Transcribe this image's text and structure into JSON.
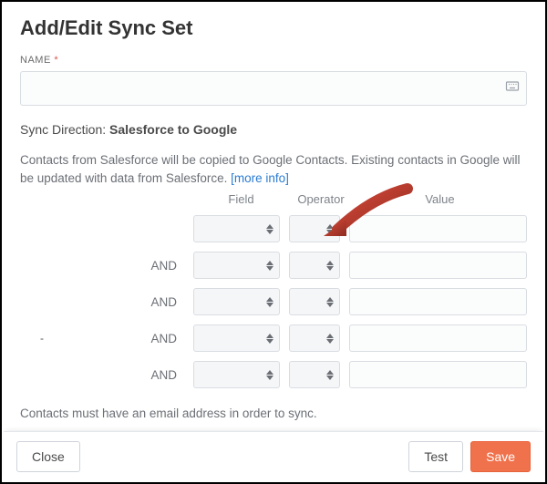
{
  "title": "Add/Edit Sync Set",
  "nameField": {
    "label": "NAME",
    "required": "*",
    "value": ""
  },
  "syncDirection": {
    "label": "Sync Direction:",
    "value": "Salesforce to Google"
  },
  "description": {
    "text": "Contacts from Salesforce will be copied to Google Contacts. Existing contacts in Google will be updated with data from Salesforce.",
    "moreLink": "[more info]"
  },
  "filterHeaders": {
    "field": "Field",
    "operator": "Operator",
    "value": "Value"
  },
  "filterRows": [
    {
      "and": "",
      "field": "",
      "operator": "",
      "value": ""
    },
    {
      "and": "AND",
      "field": "",
      "operator": "",
      "value": ""
    },
    {
      "and": "AND",
      "field": "",
      "operator": "",
      "value": ""
    },
    {
      "and": "AND",
      "field": "",
      "operator": "",
      "value": ""
    },
    {
      "and": "AND",
      "field": "",
      "operator": "",
      "value": ""
    }
  ],
  "note": "Contacts must have an email address in order to sync.",
  "buttons": {
    "close": "Close",
    "test": "Test",
    "save": "Save"
  }
}
